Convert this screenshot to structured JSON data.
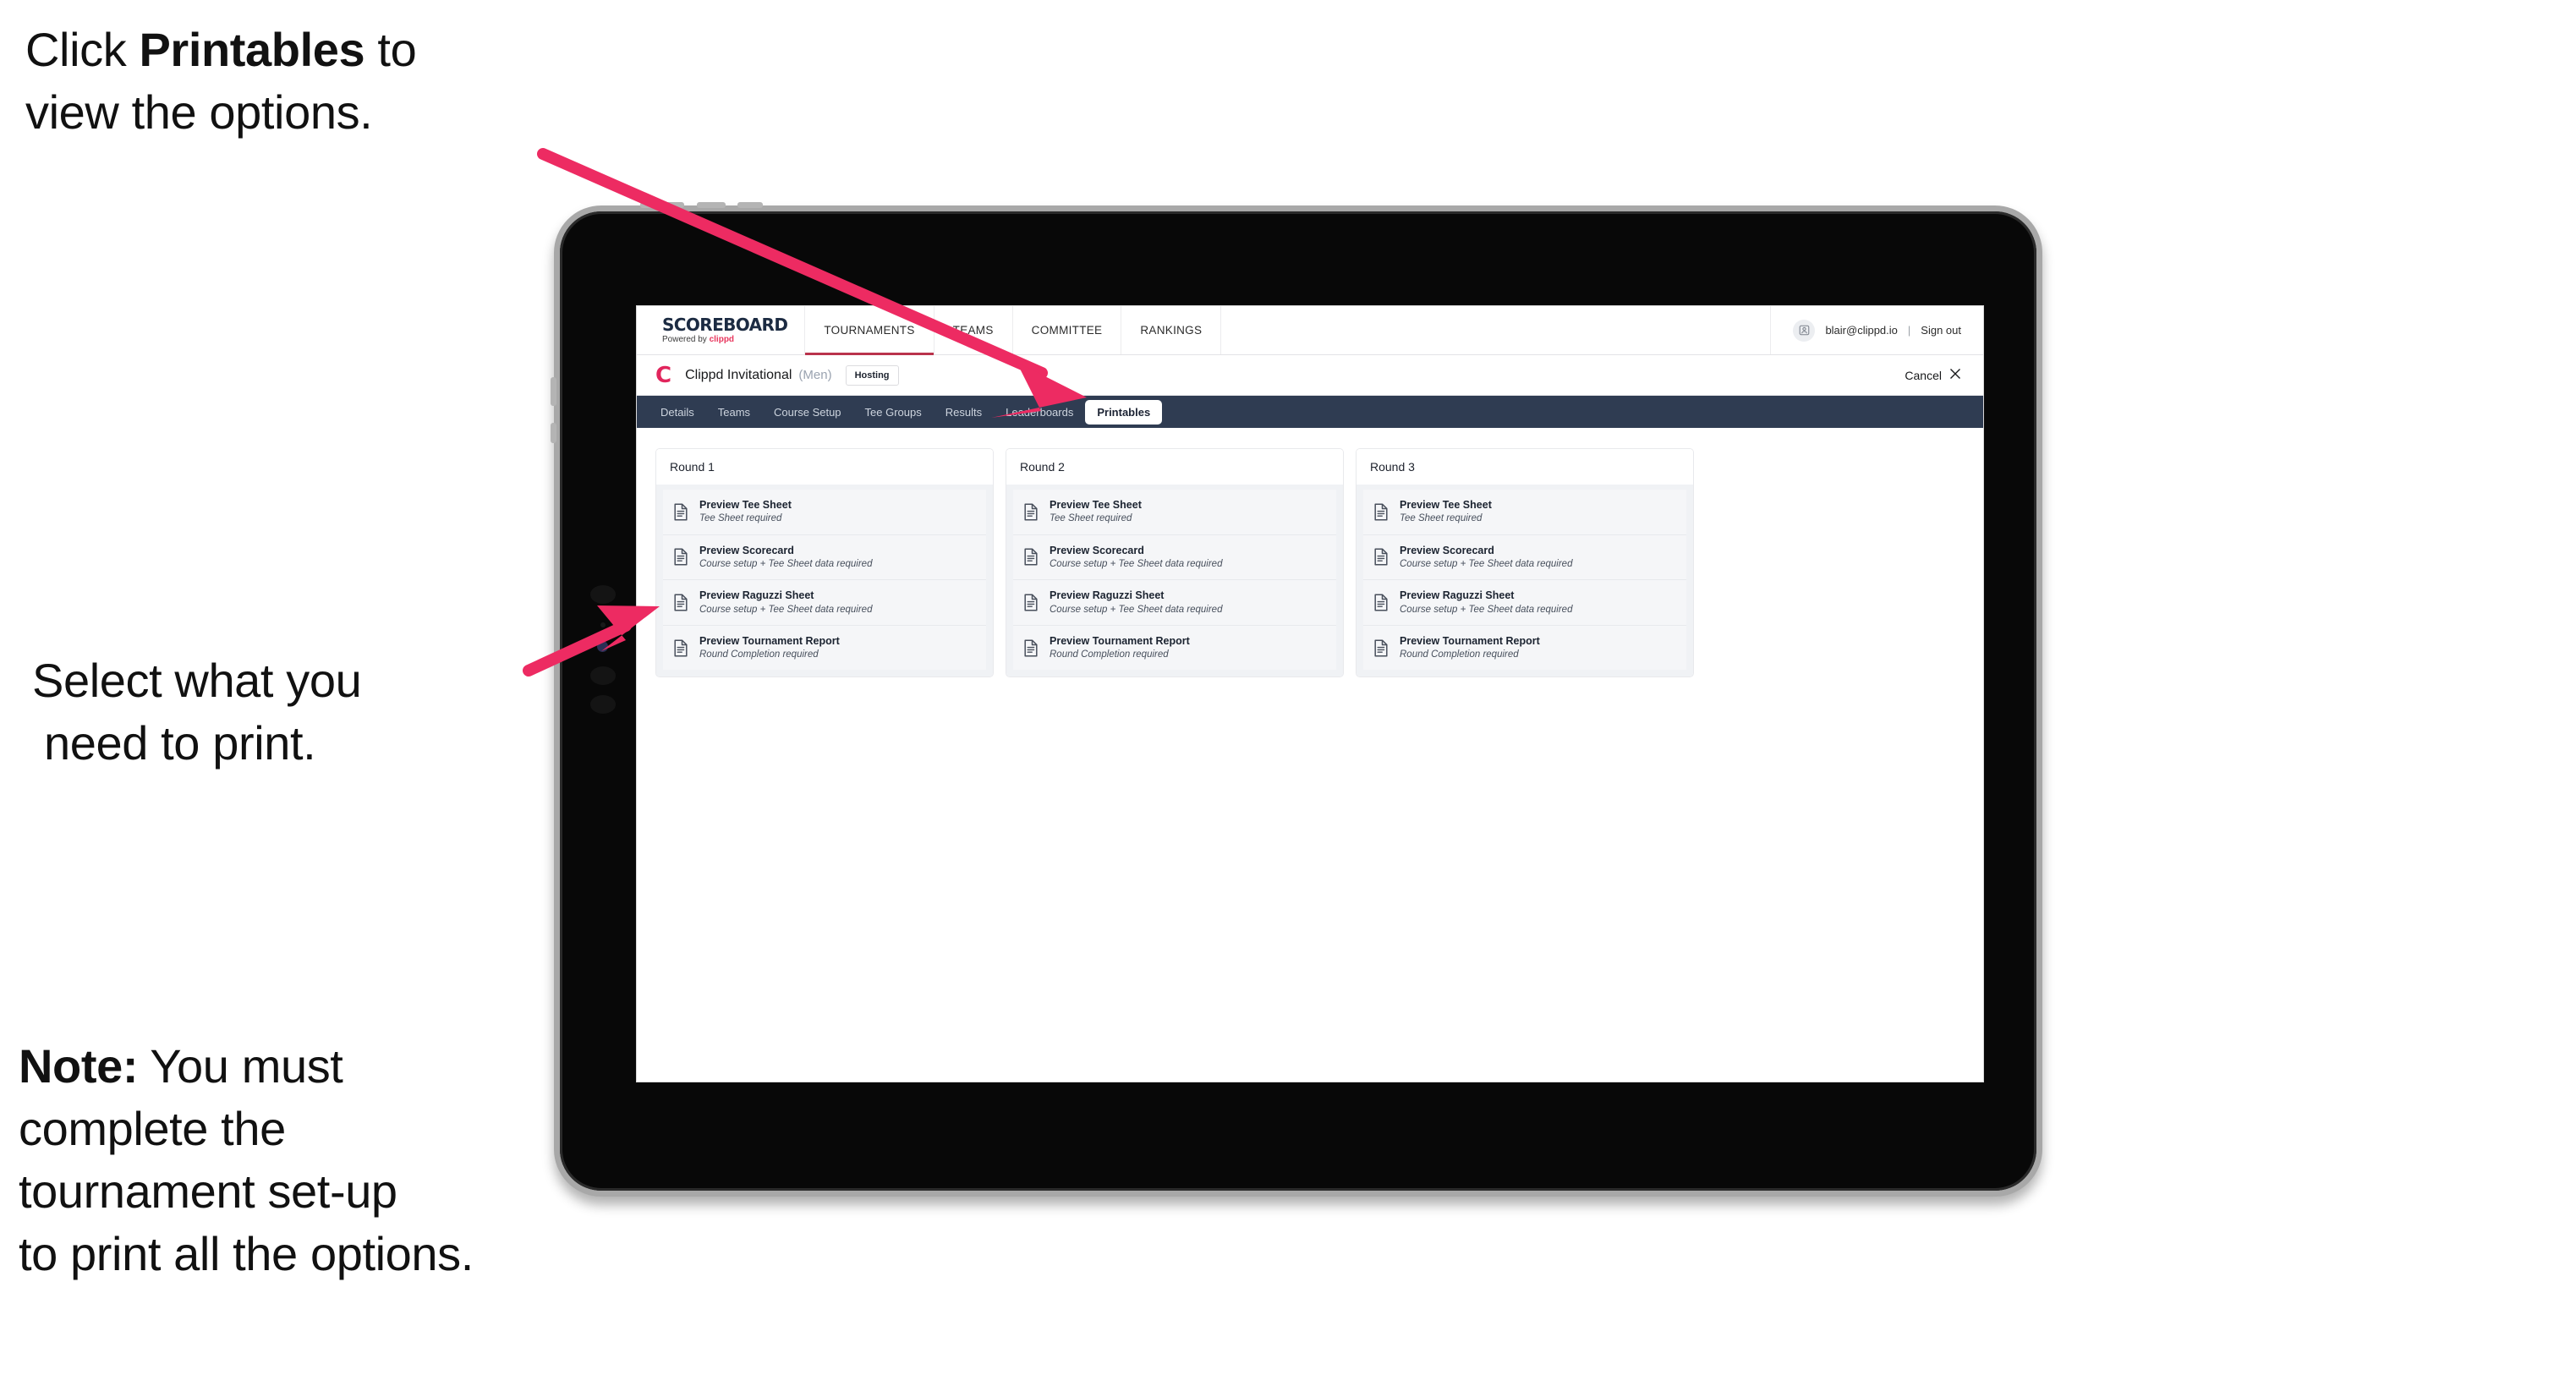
{
  "annotations": {
    "step1_prefix": "Click ",
    "step1_bold": "Printables",
    "step1_suffix": " to",
    "step1_line2": "view the options.",
    "step2_line1": "Select what you",
    "step2_line2": "need to print.",
    "note_label": "Note:",
    "note_line1": " You must",
    "note_line2": "complete the",
    "note_line3": "tournament set-up",
    "note_line4": "to print all the options.",
    "arrow_color": "#ED2B62"
  },
  "app": {
    "brand": {
      "title": "SCOREBOARD",
      "powered_prefix": "Powered by ",
      "powered_brand": "clippd"
    },
    "topnav": [
      {
        "label": "TOURNAMENTS",
        "active": true
      },
      {
        "label": "TEAMS",
        "active": false
      },
      {
        "label": "COMMITTEE",
        "active": false
      },
      {
        "label": "RANKINGS",
        "active": false
      }
    ],
    "user": {
      "avatar_icon": "user-avatar-icon",
      "email": "blair@clippd.io",
      "separator": "|",
      "sign_out": "Sign out"
    },
    "tournament": {
      "logo_mark": "C",
      "name": "Clippd Invitational",
      "gender": "(Men)",
      "status_badge": "Hosting",
      "cancel_label": "Cancel",
      "cancel_icon": "close-icon"
    },
    "tabs": [
      {
        "label": "Details",
        "active": false
      },
      {
        "label": "Teams",
        "active": false
      },
      {
        "label": "Course Setup",
        "active": false
      },
      {
        "label": "Tee Groups",
        "active": false
      },
      {
        "label": "Results",
        "active": false
      },
      {
        "label": "Leaderboards",
        "active": false
      },
      {
        "label": "Printables",
        "active": true
      }
    ],
    "rounds": [
      {
        "header": "Round 1",
        "items": [
          {
            "icon": "document-icon",
            "title": "Preview Tee Sheet",
            "subtitle": "Tee Sheet required"
          },
          {
            "icon": "document-icon",
            "title": "Preview Scorecard",
            "subtitle": "Course setup + Tee Sheet data required"
          },
          {
            "icon": "document-icon",
            "title": "Preview Raguzzi Sheet",
            "subtitle": "Course setup + Tee Sheet data required"
          },
          {
            "icon": "document-icon",
            "title": "Preview Tournament Report",
            "subtitle": "Round Completion required"
          }
        ]
      },
      {
        "header": "Round 2",
        "items": [
          {
            "icon": "document-icon",
            "title": "Preview Tee Sheet",
            "subtitle": "Tee Sheet required"
          },
          {
            "icon": "document-icon",
            "title": "Preview Scorecard",
            "subtitle": "Course setup + Tee Sheet data required"
          },
          {
            "icon": "document-icon",
            "title": "Preview Raguzzi Sheet",
            "subtitle": "Course setup + Tee Sheet data required"
          },
          {
            "icon": "document-icon",
            "title": "Preview Tournament Report",
            "subtitle": "Round Completion required"
          }
        ]
      },
      {
        "header": "Round 3",
        "items": [
          {
            "icon": "document-icon",
            "title": "Preview Tee Sheet",
            "subtitle": "Tee Sheet required"
          },
          {
            "icon": "document-icon",
            "title": "Preview Scorecard",
            "subtitle": "Course setup + Tee Sheet data required"
          },
          {
            "icon": "document-icon",
            "title": "Preview Raguzzi Sheet",
            "subtitle": "Course setup + Tee Sheet data required"
          },
          {
            "icon": "document-icon",
            "title": "Preview Tournament Report",
            "subtitle": "Round Completion required"
          }
        ]
      }
    ],
    "colors": {
      "accent_pink": "#E1255C",
      "tabbar_bg": "#2F3C52",
      "nav_underline": "#B9334C"
    }
  }
}
